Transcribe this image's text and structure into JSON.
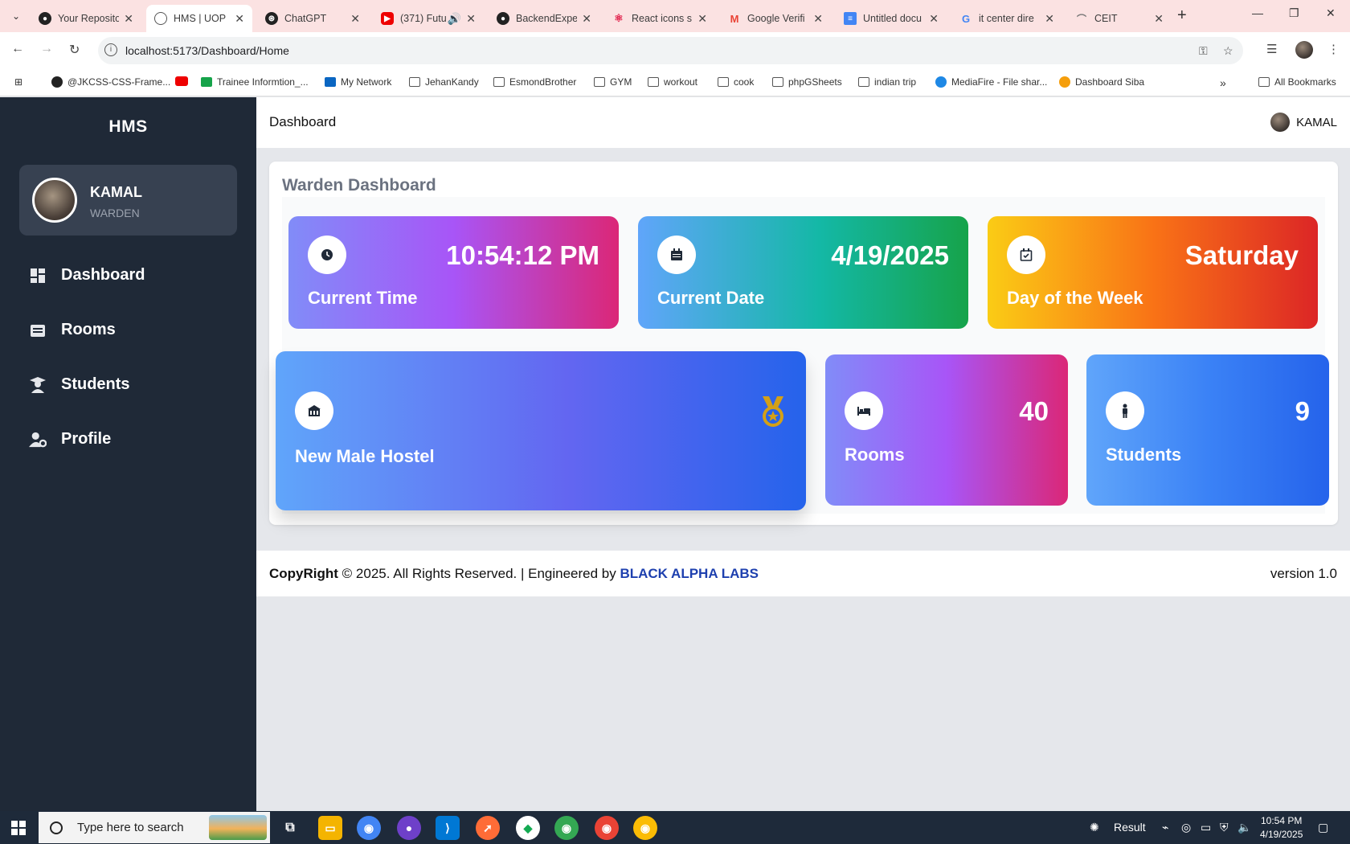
{
  "browser": {
    "tabs": [
      {
        "title": "Your Reposito",
        "icon": "github-icon"
      },
      {
        "title": "HMS | UOP",
        "icon": "globe-icon"
      },
      {
        "title": "ChatGPT",
        "icon": "chatgpt-icon"
      },
      {
        "title": "(371) Futu",
        "icon": "youtube-icon"
      },
      {
        "title": "BackendExpe",
        "icon": "github-icon"
      },
      {
        "title": "React icons s",
        "icon": "react-icon"
      },
      {
        "title": "Google Verifi",
        "icon": "gmail-icon"
      },
      {
        "title": "Untitled docu",
        "icon": "docs-icon"
      },
      {
        "title": "it center dire",
        "icon": "google-icon"
      },
      {
        "title": "CEIT",
        "icon": "ceit-icon"
      }
    ],
    "url": "localhost:5173/Dashboard/Home",
    "bookmarks": [
      {
        "label": "@JKCSS-CSS-Frame...",
        "icon": "github-icon"
      },
      {
        "label": "",
        "icon": "youtube-icon"
      },
      {
        "label": "Trainee Informtion_...",
        "icon": "sheets-icon"
      },
      {
        "label": "My Network",
        "icon": "linkedin-icon"
      },
      {
        "label": "JehanKandy",
        "icon": "folder-icon"
      },
      {
        "label": "EsmondBrother",
        "icon": "folder-icon"
      },
      {
        "label": "GYM",
        "icon": "folder-icon"
      },
      {
        "label": "workout",
        "icon": "folder-icon"
      },
      {
        "label": "cook",
        "icon": "folder-icon"
      },
      {
        "label": "phpGSheets",
        "icon": "folder-icon"
      },
      {
        "label": "indian trip",
        "icon": "folder-icon"
      },
      {
        "label": "MediaFire - File shar...",
        "icon": "mediafire-icon"
      },
      {
        "label": "Dashboard Siba",
        "icon": "sun-icon"
      }
    ],
    "all_bookmarks": "All Bookmarks"
  },
  "sidebar": {
    "brand": "HMS",
    "user": {
      "name": "KAMAL",
      "role": "WARDEN"
    },
    "items": [
      {
        "label": "Dashboard",
        "icon": "dashboard-icon"
      },
      {
        "label": "Rooms",
        "icon": "rooms-icon"
      },
      {
        "label": "Students",
        "icon": "graduate-icon"
      },
      {
        "label": "Profile",
        "icon": "user-gear-icon"
      }
    ]
  },
  "topbar": {
    "title": "Dashboard",
    "user": "KAMAL"
  },
  "main": {
    "title": "Warden Dashboard",
    "cards": {
      "time": {
        "value": "10:54:12 PM",
        "label": "Current Time",
        "icon": "clock-icon"
      },
      "date": {
        "value": "4/19/2025",
        "label": "Current Date",
        "icon": "calendar-icon"
      },
      "day": {
        "value": "Saturday",
        "label": "Day of the Week",
        "icon": "calendar-check-icon"
      },
      "hostel": {
        "label": "New Male Hostel",
        "icon": "hostel-icon",
        "badge_icon": "medal-icon"
      },
      "rooms": {
        "value": "40",
        "label": "Rooms",
        "icon": "bed-icon"
      },
      "students": {
        "value": "9",
        "label": "Students",
        "icon": "person-icon"
      }
    }
  },
  "footer": {
    "copyright_strong": "CopyRight",
    "copyright_text": " © 2025. All Rights Reserved. | Engineered by ",
    "company": "BLACK ALPHA LABS",
    "version": "version 1.0"
  },
  "taskbar": {
    "search_placeholder": "Type here to search",
    "tray_label": "Result",
    "time": "10:54 PM",
    "date": "4/19/2025"
  },
  "colors": {
    "sidebar_bg": "#1f2937",
    "accent_link": "#1e40af"
  }
}
